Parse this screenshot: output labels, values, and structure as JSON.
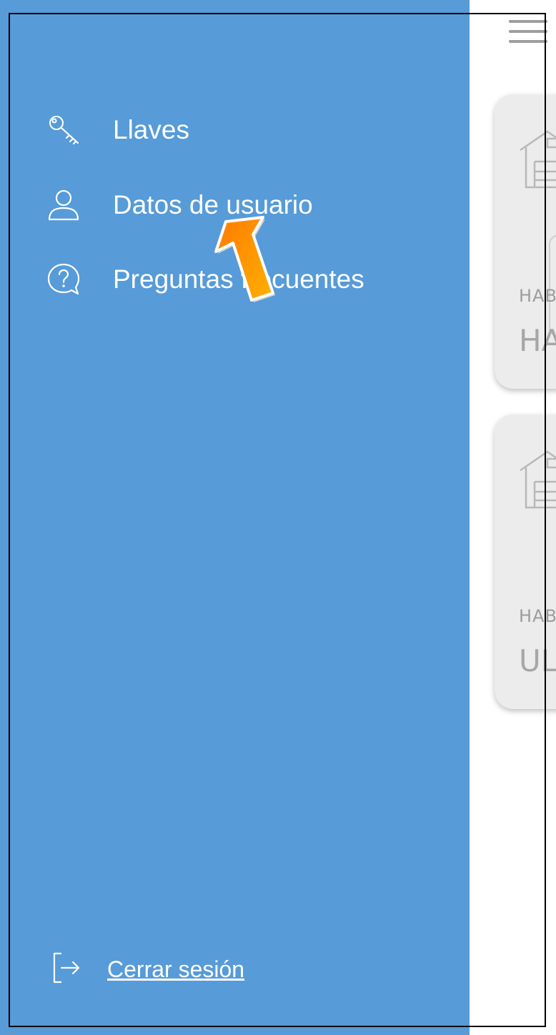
{
  "drawer": {
    "items": [
      {
        "label": "Llaves",
        "icon": "key-icon"
      },
      {
        "label": "Datos de usuario",
        "icon": "user-icon"
      },
      {
        "label": "Preguntas frecuentes",
        "icon": "help-chat-icon"
      }
    ],
    "logout_label": "Cerrar sesión",
    "background_color": "#579bd8"
  },
  "cards": [
    {
      "small": "HAB",
      "big": "HA"
    },
    {
      "small": "HAB",
      "big": "UL"
    }
  ]
}
